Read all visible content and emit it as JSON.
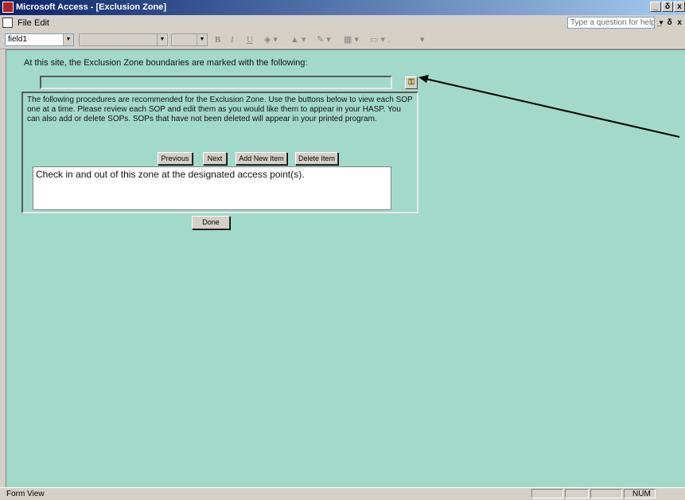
{
  "window": {
    "title": "Microsoft Access - [Exclusion Zone]",
    "controls": [
      "_",
      "δ",
      "x"
    ]
  },
  "menubar": {
    "items": [
      {
        "label": "File"
      },
      {
        "label": "Edit"
      }
    ],
    "help_placeholder": "Type a question for help",
    "mdi_controls": "_ δ x"
  },
  "toolbar": {
    "object_combo": "field1",
    "font_combo": "",
    "size_combo": "",
    "bold": "B",
    "italic": "I",
    "underline": "U"
  },
  "form": {
    "boundary_label": "At this site, the Exclusion Zone boundaries are marked with the following:",
    "boundary_value": "",
    "instructions": "The following procedures are recommended for the Exclusion Zone.  Use the buttons below to view each SOP one at a time.  Please review each SOP and edit them as you would like them to appear in your HASP.  You can also add or delete SOPs.  SOPs that have not been deleted will appear in your printed program.",
    "buttons": {
      "previous": "Previous",
      "next": "Next",
      "add": "Add New Item",
      "delete": "Delete Item",
      "done": "Done"
    },
    "sop_text": "Check in and out of this zone at the designated access point(s)."
  },
  "statusbar": {
    "view": "Form View",
    "num": "NUM"
  },
  "colors": {
    "form_background": "#a2d9c9",
    "title_bar_start": "#0a246a",
    "title_bar_end": "#a6caf0"
  }
}
